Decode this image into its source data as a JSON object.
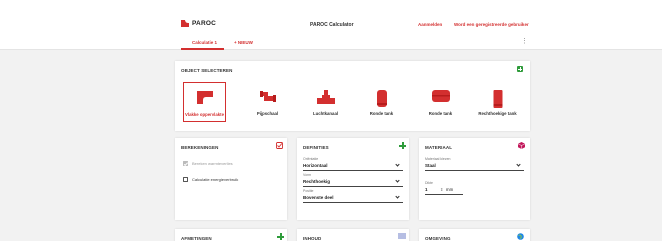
{
  "header": {
    "brand": "PAROC",
    "app_title": "PAROC Calculator",
    "links": [
      "Aanmelden",
      "Word een geregistreerde gebruiker"
    ]
  },
  "tabs": {
    "active": "Calculatie 1",
    "add": "+ NIEUW",
    "more": "⋮"
  },
  "object_select": {
    "title": "OBJECT SELECTEREN",
    "items": [
      {
        "label": "Vlakke oppervlakte",
        "icon": "flat-surface-icon",
        "selected": true
      },
      {
        "label": "Pijpschaal",
        "icon": "pipe-section-icon",
        "selected": false
      },
      {
        "label": "Luchtkanaal",
        "icon": "air-duct-icon",
        "selected": false
      },
      {
        "label": "Ronde tank",
        "icon": "round-tank-vertical-icon",
        "selected": false
      },
      {
        "label": "Ronde tank",
        "icon": "round-tank-horizontal-icon",
        "selected": false
      },
      {
        "label": "Rechthoekige tank",
        "icon": "rectangular-tank-icon",
        "selected": false
      }
    ]
  },
  "berekeningen": {
    "title": "BEREKENINGEN",
    "options": [
      {
        "label": "Bereken warmteverlies",
        "checked": true
      },
      {
        "label": "Calculatie energieverbruik",
        "checked": false
      }
    ]
  },
  "definities": {
    "title": "DEFINITIES",
    "fields": [
      {
        "label": "Oriëntatie",
        "value": "Horizontaal"
      },
      {
        "label": "Vorm",
        "value": "Rechthoekig"
      },
      {
        "label": "Positie",
        "value": "Bovenste deel"
      }
    ]
  },
  "materiaal": {
    "title": "MATERIAAL",
    "fields": [
      {
        "label": "Materiaal kiezen",
        "value": "Staal"
      },
      {
        "label": "Dikte",
        "value": "1",
        "unit": "mm"
      }
    ]
  },
  "bottom_cards": [
    {
      "title": "AFMETINGEN"
    },
    {
      "title": "INHOUD"
    },
    {
      "title": "OMGEVING"
    }
  ],
  "colors": {
    "accent": "#d32f2f",
    "add": "#2e9b3a",
    "background": "#f2f2f2",
    "card": "#ffffff"
  }
}
